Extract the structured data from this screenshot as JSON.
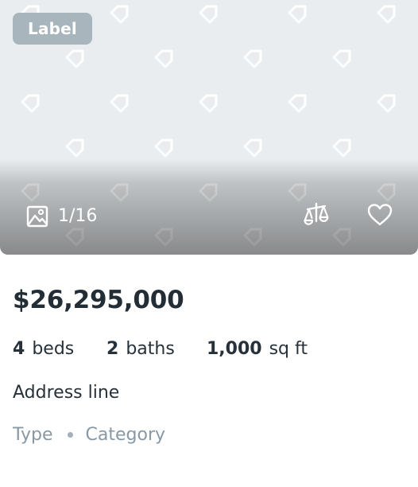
{
  "listing": {
    "badge": "Label",
    "photo_counter": "1/16",
    "price": "$26,295,000",
    "beds": {
      "value": "4",
      "unit": "beds"
    },
    "baths": {
      "value": "2",
      "unit": "baths"
    },
    "area": {
      "value": "1,000",
      "unit": "sq ft"
    },
    "address": "Address line",
    "type": "Type",
    "category": "Category"
  },
  "icons": {
    "photos": "image-icon",
    "compare": "balance-scale-icon",
    "favorite": "heart-icon",
    "placeholder": "tag-icon"
  },
  "colors": {
    "badge_bg": "#a8b5bd",
    "media_bg": "#e9edf0",
    "text_primary": "#222d36",
    "text_muted": "#8799a6"
  }
}
